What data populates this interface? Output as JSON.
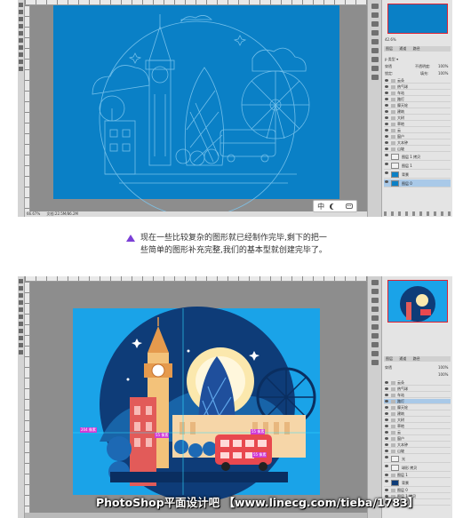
{
  "top_screenshot": {
    "status_zoom": "66.67%",
    "status_doc": "文档:22.5M/86.2M",
    "panel": {
      "zoom_value": "42.6%",
      "tabs": [
        "图层",
        "通道",
        "路径"
      ],
      "mode": "穿透",
      "opacity_label": "不透明度:",
      "opacity_value": "100%",
      "lock_label": "锁定:",
      "fill_label": "填充:",
      "fill_value": "100%",
      "layers": [
        "云朵",
        "热气球",
        "车站",
        "路灯",
        "摩天轮",
        "建筑",
        "大树",
        "草地",
        "云",
        "窗户",
        "大本钟",
        "山坡",
        "图层 1 拷贝",
        "图层 1",
        "背景",
        "图层 0"
      ],
      "selected_index": 15
    }
  },
  "caption": {
    "line1": "现在一些比较复杂的图形就已经制作完毕,剩下的把一",
    "line2": "些简单的图形补充完整,我们的基本型就创建完毕了。"
  },
  "ime": {
    "mode_label": "中",
    "extra": "••"
  },
  "bottom_screenshot": {
    "panel": {
      "tabs": [
        "图层",
        "通道",
        "路径"
      ],
      "mode": "穿透",
      "opacity_value": "100%",
      "fill_value": "100%",
      "layers": [
        "云朵",
        "热气球",
        "车站",
        "路灯",
        "摩天轮",
        "建筑",
        "大树",
        "草地",
        "云",
        "窗户",
        "大本钟",
        "山坡",
        "光",
        "球形 拷贝",
        "图层 1",
        "背景",
        "图层 0",
        "图层 1 拷贝",
        "图层 1"
      ],
      "selected_index": 3
    },
    "guide_labels": [
      "204 像素",
      "55 像素",
      "55 像素",
      "55 像素"
    ]
  },
  "watermark": "PhotoShop平面设计吧 【www.linecg.com/tieba/1783】",
  "colors": {
    "canvas_blue": "#0a80c6",
    "bottom_canvas_blue": "#1aa3e8",
    "dark_circle": "#0e3c78",
    "tower_red": "#e25b59",
    "bus_red": "#e8484f",
    "sun": "#fbe8ad"
  }
}
